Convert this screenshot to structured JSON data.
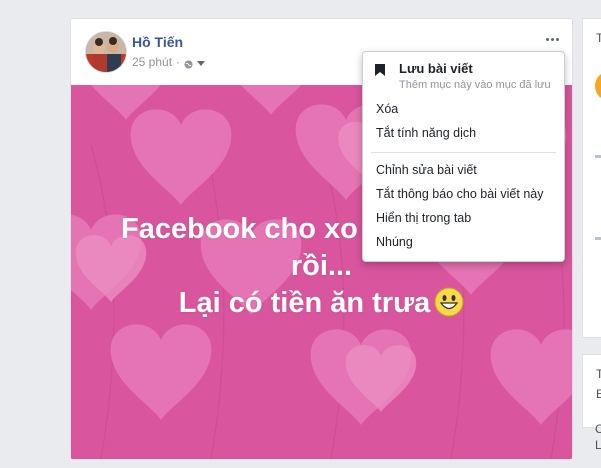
{
  "post": {
    "author": "Hồ Tiến",
    "time": "25 phút",
    "separator": "·",
    "text_line1": "Facebook cho xo",
    "text_line2": "rồi...",
    "text_line3": "Lại có tiền ăn trưa",
    "background_color": "#d9559d"
  },
  "menu": {
    "save_title": "Lưu bài viết",
    "save_subtitle": "Thêm mục này vào mục đã lưu",
    "items": [
      "Xóa",
      "Tắt tính năng dịch",
      "Chỉnh sửa bài viết",
      "Tắt thông báo cho bài viết này",
      "Hiển thị trong tab",
      "Nhúng"
    ]
  },
  "sidebar": {
    "letters": [
      "T",
      "T",
      "E",
      "C",
      "L"
    ]
  },
  "icons": [
    "more-options-icon",
    "globe-icon",
    "caret-down-icon",
    "bookmark-icon",
    "grinning-emoji-icon"
  ]
}
